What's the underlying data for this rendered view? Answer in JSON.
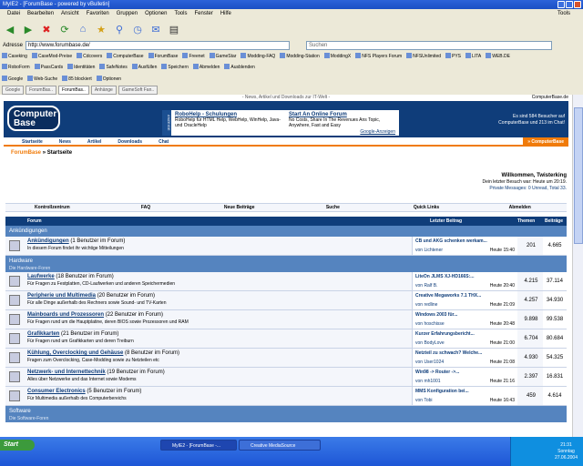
{
  "window": {
    "title": "MyIE2 - [ForumBase - powered by vBulletin]"
  },
  "menu": [
    "Datei",
    "Bearbeiten",
    "Ansicht",
    "Favoriten",
    "Gruppen",
    "Optionen",
    "Tools",
    "Fenster",
    "Hilfe"
  ],
  "menu_right": "Tools",
  "address": {
    "label": "Adresse",
    "url": "http://www.forumbase.de/",
    "search_label": "Suchen"
  },
  "links1": [
    "Caseking",
    "CaseMod-Preise",
    "Cdcovers",
    "ComputerBase",
    "ForumBase",
    "Freenet",
    "GameStar",
    "Modding-FAQ",
    "Modding-Station",
    "ModdingX",
    "NFS Players Forum",
    "NFSUnlimited",
    "PYS",
    "LITA",
    "WEB.DE"
  ],
  "links2": [
    "RoboForm",
    "PassCards",
    "Identitäten",
    "SafeNotes",
    "Ausfüllen",
    "Speichern",
    "Abmelden",
    "Ausblenden"
  ],
  "links3": [
    "Google",
    "Web-Suche",
    "85 blockiert",
    "Optionen"
  ],
  "tabs": [
    "Google",
    "ForumBas..",
    "ForumBas..",
    "Anhänge",
    "GameSoft Fan.."
  ],
  "site": {
    "topline": "- News, Artikel und Downloads zur IT-Welt -",
    "topline_right": "ComputerBase.de",
    "logo1": "Computer",
    "logo2": "Base",
    "ad_side": "ANZEIGE",
    "ad1_title": "RoboHelp - Schulungen",
    "ad1_text": "RoboHelp für HTML Help, WebHelp, WinHelp, Java- und OracleHelp",
    "ad2_title": "Start An Online Forum",
    "ad2_text": "No Costs, Share In The Revenues Ans Topic, Anywhere, Fast and Easy",
    "ad_google": "Google-Anzeigen",
    "visitors": "Es sind 584 Besucher auf ComputerBase und 213 im Chat!",
    "nav": [
      "Startseite",
      "News",
      "Artikel",
      "Downloads",
      "Chat"
    ],
    "nav_cb": "» ComputerBase",
    "crumb_a": "ForumBase",
    "crumb_b": "» Startseite",
    "welcome_title": "Willkommen, Twisterking",
    "welcome_last": "Dein letzter Besuch war: Heute um 20:19.",
    "welcome_pm": "Private Messages: 0 Unread, Total 33.",
    "ctrl": [
      "Kontrollzentrum",
      "FAQ",
      "Neue Beiträge",
      "Suche",
      "Quick Links",
      "Abmelden"
    ],
    "col_forum": "Forum",
    "col_last": "Letzter Beitrag",
    "col_threads": "Themen",
    "col_posts": "Beiträge"
  },
  "forum": {
    "cat1": "Ankündigungen",
    "ann": {
      "title": "Ankündigungen",
      "users": "(1 Benutzer im Forum)",
      "desc": "In diesem Forum findet ihr wichtige Mitteilungen",
      "last": "CB und AKG schenken werkam...",
      "by": "von Lichtener",
      "time": "Heute 15:40",
      "n1": "201",
      "n2": "4.665"
    },
    "cat2": "Hardware",
    "cat2_sub": "Die Hardware-Foren",
    "rows": [
      {
        "title": "Laufwerke",
        "users": "(18 Benutzer im Forum)",
        "desc": "Für Fragen zu Festplatten, CD-Laufwerken und anderen Speichermedien",
        "last": "LiteOn JLMS XJ-HD166S:...",
        "by": "von Ralf B.",
        "time": "Heute 20:40",
        "n1": "4.215",
        "n2": "37.114"
      },
      {
        "title": "Peripherie und Multimedia",
        "users": "(20 Benutzer im Forum)",
        "desc": "Für alle Dinge außerhalb des Rechners sowie Sound- und TV-Karten",
        "last": "Creative Megaworks 7.1 THX...",
        "by": "von redline",
        "time": "Heute 21:09",
        "n1": "4.257",
        "n2": "34.930"
      },
      {
        "title": "Mainboards und Prozessoren",
        "users": "(22 Benutzer im Forum)",
        "desc": "Für Fragen rund um die Hauptplatine, deren BIOS sowie Prozessoren und RAM",
        "last": "Windows 2003 für...",
        "by": "von hoschisse",
        "time": "Heute 20:48",
        "n1": "9.898",
        "n2": "99.538"
      },
      {
        "title": "Grafikkarten",
        "users": "(21 Benutzer im Forum)",
        "desc": "Für Fragen rund um Grafikkarten und deren Treiburn",
        "last": "Kurzer Erfahrungsbericht...",
        "by": "von BodyLove",
        "time": "Heute 21:00",
        "n1": "6.704",
        "n2": "80.684"
      },
      {
        "title": "Kühlung, Overclocking und Gehäuse",
        "users": "(8 Benutzer im Forum)",
        "desc": "Fragen zum Overclocking, Case-Modding sowie zu Netzteilen etc",
        "last": "Netzteil zu schwach? Welche...",
        "by": "von User1024",
        "time": "Heute 21:08",
        "n1": "4.930",
        "n2": "54.325"
      },
      {
        "title": "Netzwerk- und Internettechnik",
        "users": "(19 Benutzer im Forum)",
        "desc": "Alles über Netzwerke und das Internet sowie Modems",
        "last": "Win98 -> Router ->...",
        "by": "von mh1001",
        "time": "Heute 21:16",
        "n1": "2.397",
        "n2": "16.831"
      },
      {
        "title": "Consumer Electronics",
        "users": "(5 Benutzer im Forum)",
        "desc": "Für Multimedia außerhalb des Computerbereichs",
        "last": "MMS Konfiguration bei...",
        "by": "von Tobi",
        "time": "Heute 16:43",
        "n1": "459",
        "n2": "4.614"
      }
    ],
    "cat3": "Software",
    "cat3_sub": "Die Software-Foren"
  },
  "taskbar": {
    "start": "Start",
    "tasks": [
      "MyIE2 - [ForumBase -...",
      "Creative MediaSource"
    ],
    "time": "21:31",
    "day": "Sonntag",
    "date": "27.06.2004"
  }
}
